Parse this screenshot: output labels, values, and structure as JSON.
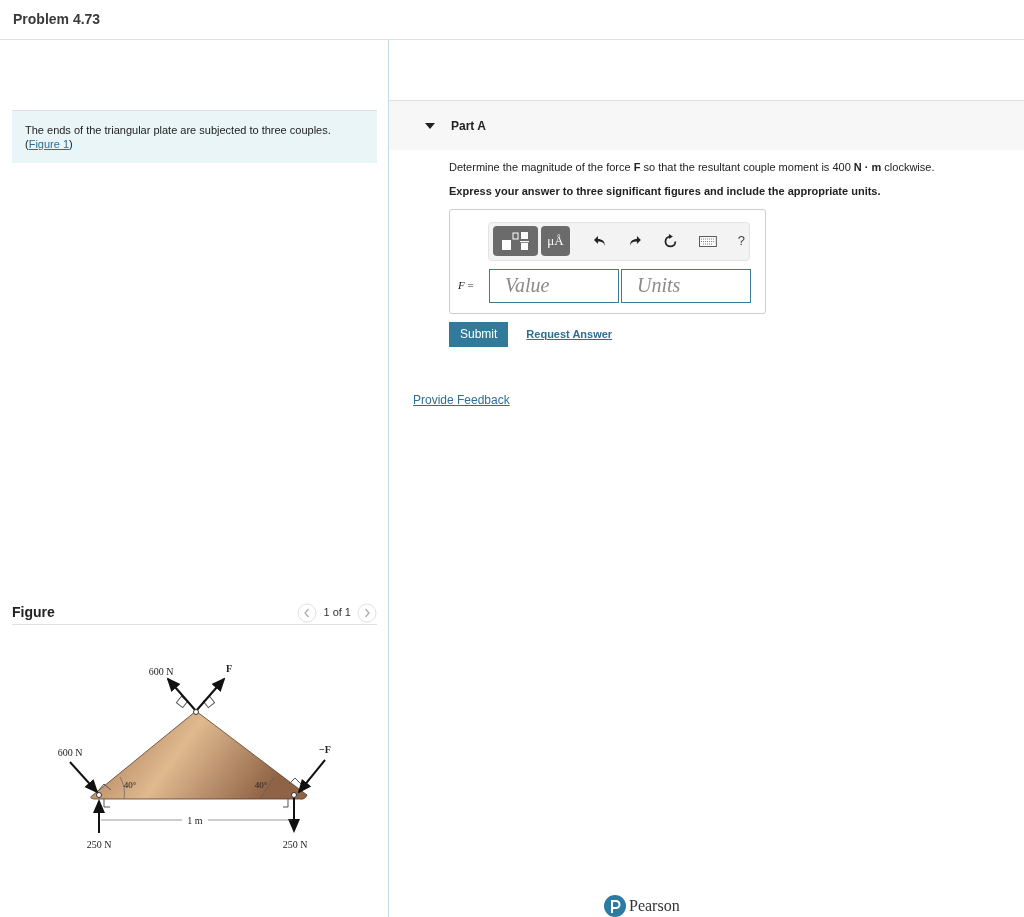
{
  "title": "Problem 4.73",
  "intro": {
    "text": "The ends of the triangular plate are subjected to three couples.",
    "open": "(",
    "link": "Figure 1",
    "close": ")"
  },
  "figure": {
    "heading": "Figure",
    "pager": "1 of 1",
    "labels": [
      {
        "kind": "top-left",
        "text": "600 N"
      },
      {
        "kind": "top-right",
        "text": "F"
      },
      {
        "kind": "left",
        "text": "600 N"
      },
      {
        "kind": "right",
        "text": "−F"
      },
      {
        "kind": "angle-left",
        "text": "40°"
      },
      {
        "kind": "angle-right",
        "text": "40°"
      },
      {
        "kind": "span",
        "text": "1 m"
      },
      {
        "kind": "bottom-left",
        "text": "250 N"
      },
      {
        "kind": "bottom-right",
        "text": "250 N"
      }
    ]
  },
  "part": {
    "label": "Part A",
    "expanded": true,
    "question": "Determine the magnitude of the force **F** so that the resultant couple moment is 400  **N · m** clockwise.",
    "instruction": "Express your answer to three significant figures and include the appropriate units.",
    "units_button": "μÅ",
    "help": "?",
    "variable": "F",
    "equals": "=",
    "value_placeholder": "Value",
    "units_placeholder": "Units",
    "submit": "Submit",
    "request": "Request Answer"
  },
  "feedback": "Provide Feedback",
  "footer": "Pearson"
}
